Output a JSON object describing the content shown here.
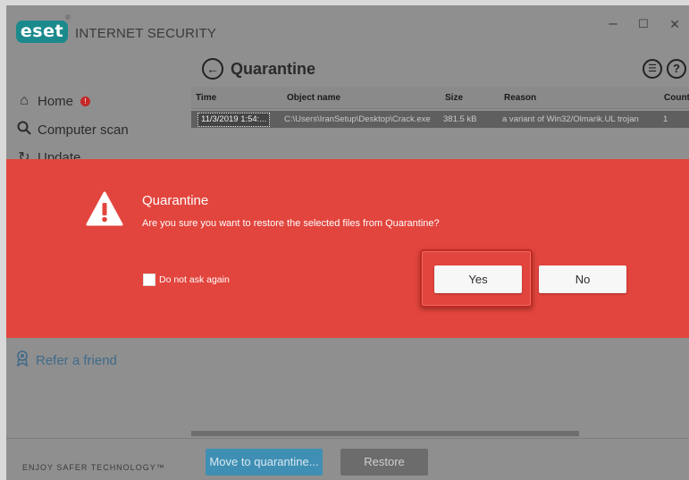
{
  "window": {
    "brand_logo": "eset",
    "product_name": "INTERNET SECURITY",
    "controls": {
      "minimize": "–",
      "maximize": "☐",
      "close": "✕"
    }
  },
  "header": {
    "title": "Quarantine"
  },
  "sidebar": {
    "items": [
      {
        "label": "Home",
        "icon": "home-icon",
        "badge": "!"
      },
      {
        "label": "Computer scan",
        "icon": "search-icon"
      },
      {
        "label": "Update",
        "icon": "refresh-icon"
      }
    ],
    "refer_label": "Refer a friend",
    "tagline": "ENJOY SAFER TECHNOLOGY™"
  },
  "table": {
    "columns": [
      "Time",
      "Object name",
      "Size",
      "Reason",
      "Count"
    ],
    "rows": [
      {
        "time": "11/3/2019 1:54:...",
        "object": "C:\\Users\\IranSetup\\Desktop\\Crack.exe",
        "size": "381.5 kB",
        "reason": "a variant of Win32/Olmarik.UL trojan",
        "count": "1"
      }
    ]
  },
  "footer": {
    "move_label": "Move to quarantine...",
    "restore_label": "Restore"
  },
  "dialog": {
    "title": "Quarantine",
    "message": "Are you sure you want to restore the selected files from Quarantine?",
    "checkbox_label": "Do not ask again",
    "checkbox_checked": false,
    "yes_label": "Yes",
    "no_label": "No",
    "color": "#e2453d"
  },
  "colors": {
    "brand": "#1b8a8c",
    "primary_button": "#3f8fb4",
    "highlight_border": "#c22a22"
  }
}
